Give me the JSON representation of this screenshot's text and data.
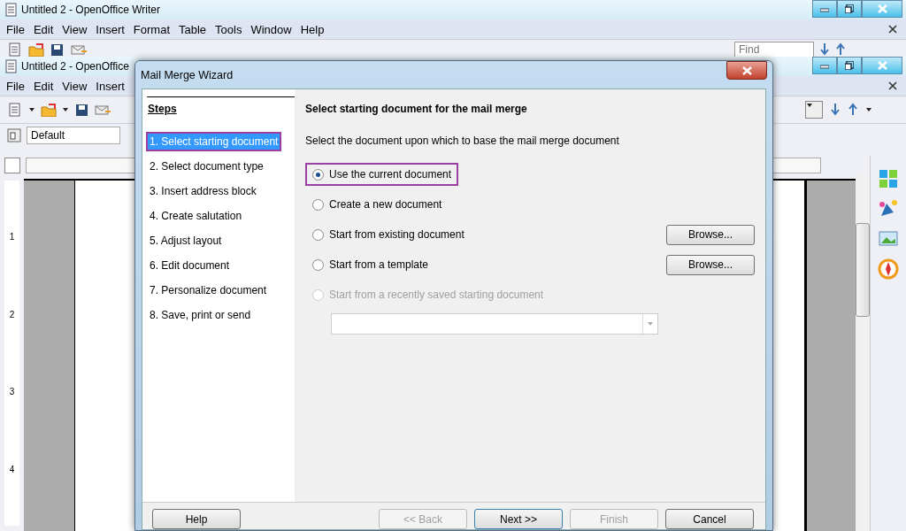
{
  "back_window": {
    "title": "Untitled 2 - OpenOffice Writer",
    "menu": [
      "File",
      "Edit",
      "View",
      "Insert",
      "Format",
      "Table",
      "Tools",
      "Window",
      "Help"
    ],
    "find_placeholder": "Find"
  },
  "front_window": {
    "title": "Untitled 2 - OpenOffice",
    "menu": [
      "File",
      "Edit",
      "View",
      "Insert"
    ],
    "paragraph_style": "Default",
    "ruler_numbers": [
      "1",
      "2",
      "3",
      "4"
    ]
  },
  "dialog": {
    "title": "Mail Merge Wizard",
    "steps_heading": "Steps",
    "steps": [
      {
        "label": "1. Select starting document",
        "selected": true
      },
      {
        "label": "2. Select document type",
        "selected": false
      },
      {
        "label": "3. Insert address block",
        "selected": false
      },
      {
        "label": "4. Create salutation",
        "selected": false
      },
      {
        "label": "5. Adjust layout",
        "selected": false
      },
      {
        "label": "6. Edit document",
        "selected": false
      },
      {
        "label": "7. Personalize document",
        "selected": false
      },
      {
        "label": "8. Save, print or send",
        "selected": false
      }
    ],
    "heading": "Select starting document for the mail merge",
    "instruction": "Select the document upon which to base the mail merge document",
    "options": [
      {
        "label": "Use the current document",
        "selected": true,
        "disabled": false
      },
      {
        "label": "Create a new document",
        "selected": false,
        "disabled": false
      },
      {
        "label": "Start from existing document",
        "selected": false,
        "disabled": false,
        "button": "Browse..."
      },
      {
        "label": "Start from a template",
        "selected": false,
        "disabled": false,
        "button": "Browse..."
      },
      {
        "label": "Start from a recently saved starting document",
        "selected": false,
        "disabled": true
      }
    ],
    "recent_document_field": {
      "disabled": true
    },
    "buttons": [
      {
        "label": "Help",
        "disabled": false,
        "default": false
      },
      {
        "label": "<< Back",
        "disabled": true,
        "default": false
      },
      {
        "label": "Next >>",
        "disabled": false,
        "default": true
      },
      {
        "label": "Finish",
        "disabled": true,
        "default": false
      },
      {
        "label": "Cancel",
        "disabled": false,
        "default": false
      }
    ]
  }
}
